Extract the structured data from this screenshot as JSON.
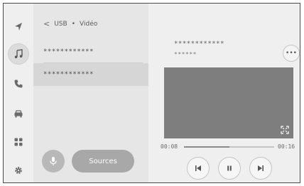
{
  "nav": {
    "items": [
      {
        "icon": "navigation-arrow-icon",
        "active": false
      },
      {
        "icon": "music-note-icon",
        "active": true
      },
      {
        "icon": "phone-icon",
        "active": false
      },
      {
        "icon": "car-icon",
        "active": false
      },
      {
        "icon": "apps-grid-icon",
        "active": false
      },
      {
        "icon": "settings-gear-icon",
        "active": false
      }
    ]
  },
  "browser": {
    "back_glyph": "<",
    "breadcrumb_source": "USB",
    "breadcrumb_separator": "•",
    "breadcrumb_folder": "Vidéo",
    "items": [
      {
        "label": "************",
        "selected": false
      },
      {
        "label": "************",
        "selected": true
      }
    ],
    "sources_label": "Sources"
  },
  "now_playing": {
    "title": "************",
    "subtitle": "******",
    "more_label": "•••",
    "elapsed": "00:08",
    "duration": "00:16",
    "progress": 0.5
  },
  "colors": {
    "accent": "#a8a8a8",
    "video_bg": "#7e7e7e"
  }
}
